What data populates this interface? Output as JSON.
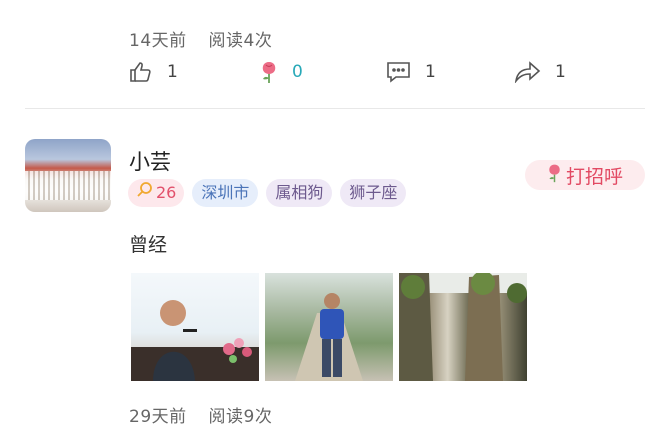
{
  "post1": {
    "time": "14天前",
    "reads": "阅读4次",
    "likes": "1",
    "flowers": "0",
    "comments": "1",
    "shares": "1"
  },
  "user": {
    "name": "小芸",
    "level": "26",
    "tags": [
      "深圳市",
      "属相狗",
      "狮子座"
    ],
    "greet_label": "打招呼"
  },
  "post2": {
    "text": "曾经",
    "time": "29天前",
    "reads": "阅读9次"
  },
  "colors": {
    "accent_pink": "#e24a63",
    "flower_count_teal": "#28a9b8",
    "city_blue": "#4b74b8"
  }
}
